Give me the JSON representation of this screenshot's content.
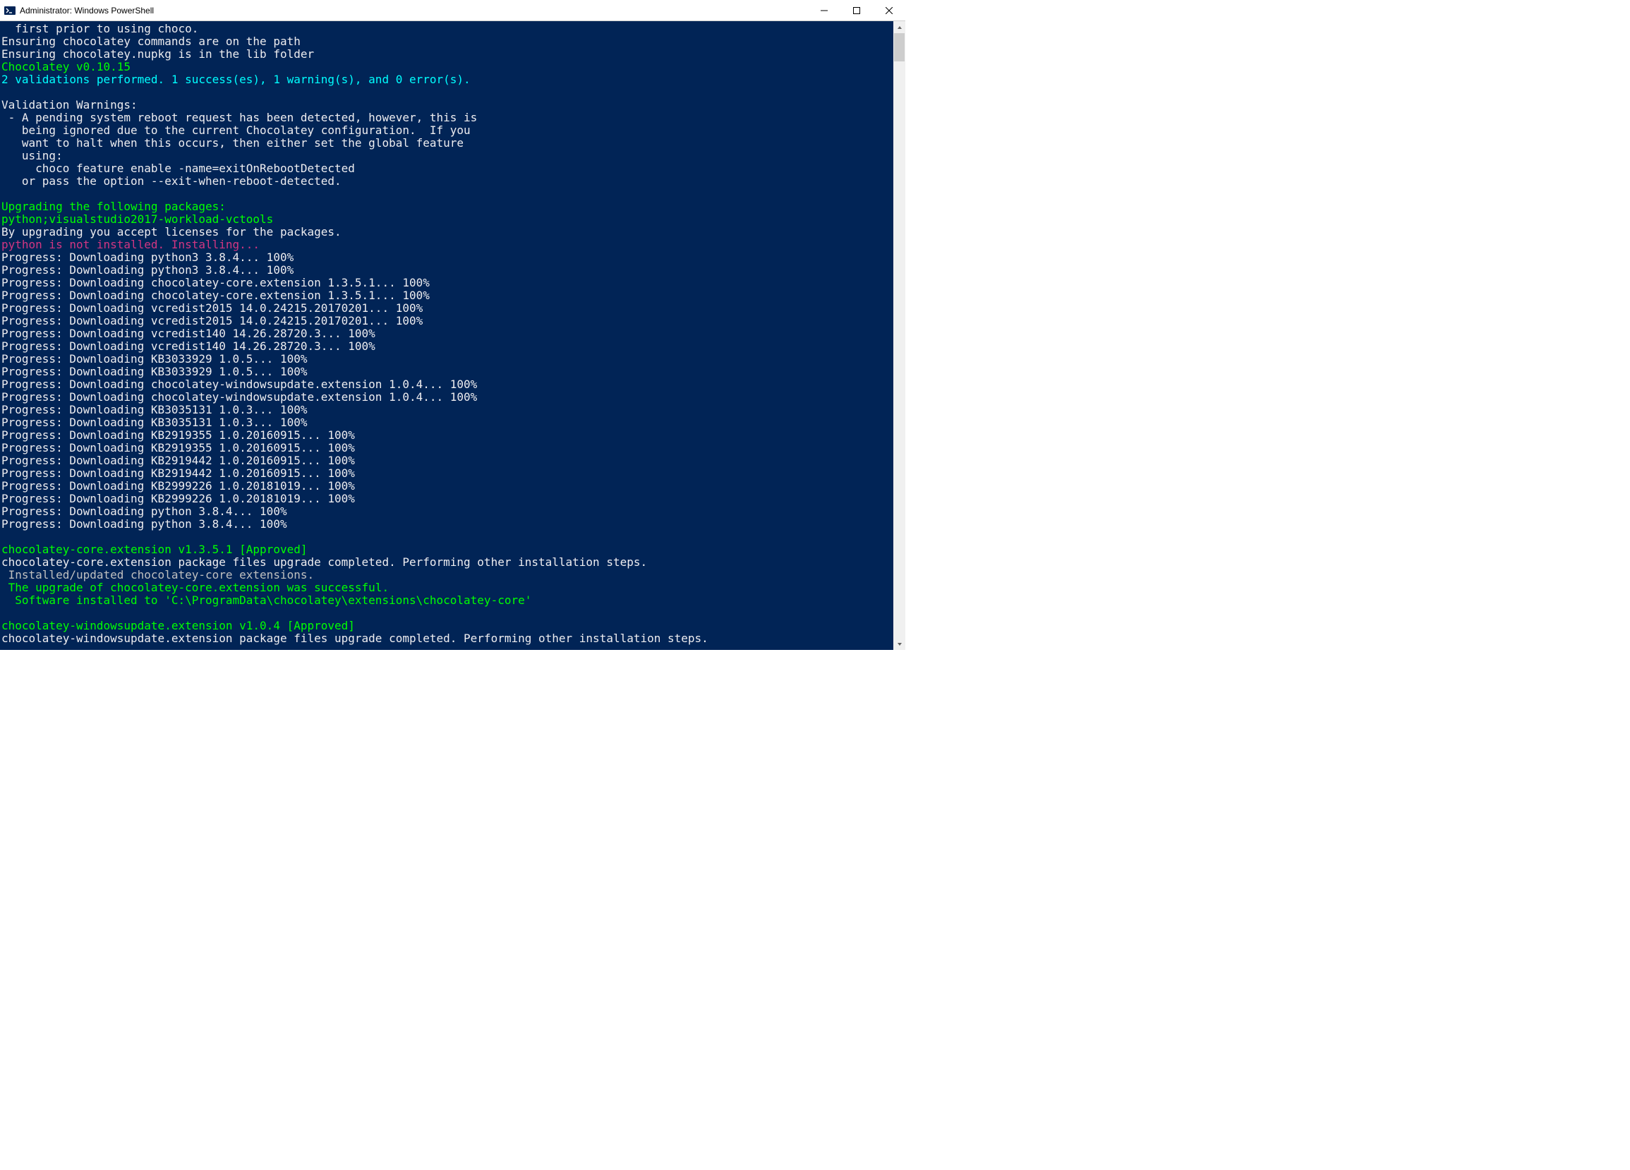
{
  "window": {
    "title": "Administrator: Windows PowerShell"
  },
  "colors": {
    "terminal_bg": "#012456",
    "white": "#eeedf0",
    "silver": "#c0c0c0",
    "green": "#00ff00",
    "cyan": "#00ffff",
    "magenta": "#d33682"
  },
  "lines": [
    {
      "cls": "c-white",
      "t": "  first prior to using choco."
    },
    {
      "cls": "c-white",
      "t": "Ensuring chocolatey commands are on the path"
    },
    {
      "cls": "c-white",
      "t": "Ensuring chocolatey.nupkg is in the lib folder"
    },
    {
      "cls": "c-green",
      "t": "Chocolatey v0.10.15"
    },
    {
      "cls": "c-cyan",
      "t": "2 validations performed. 1 success(es), 1 warning(s), and 0 error(s)."
    },
    {
      "cls": "c-white",
      "t": ""
    },
    {
      "cls": "c-white",
      "t": "Validation Warnings:"
    },
    {
      "cls": "c-white",
      "t": " - A pending system reboot request has been detected, however, this is"
    },
    {
      "cls": "c-white",
      "t": "   being ignored due to the current Chocolatey configuration.  If you"
    },
    {
      "cls": "c-white",
      "t": "   want to halt when this occurs, then either set the global feature"
    },
    {
      "cls": "c-white",
      "t": "   using:"
    },
    {
      "cls": "c-white",
      "t": "     choco feature enable -name=exitOnRebootDetected"
    },
    {
      "cls": "c-white",
      "t": "   or pass the option --exit-when-reboot-detected."
    },
    {
      "cls": "c-white",
      "t": ""
    },
    {
      "cls": "c-green",
      "t": "Upgrading the following packages:"
    },
    {
      "cls": "c-green",
      "t": "python;visualstudio2017-workload-vctools"
    },
    {
      "cls": "c-white",
      "t": "By upgrading you accept licenses for the packages."
    },
    {
      "cls": "c-magenta",
      "t": "python is not installed. Installing..."
    },
    {
      "cls": "c-white",
      "t": "Progress: Downloading python3 3.8.4... 100%"
    },
    {
      "cls": "c-white",
      "t": "Progress: Downloading python3 3.8.4... 100%"
    },
    {
      "cls": "c-white",
      "t": "Progress: Downloading chocolatey-core.extension 1.3.5.1... 100%"
    },
    {
      "cls": "c-white",
      "t": "Progress: Downloading chocolatey-core.extension 1.3.5.1... 100%"
    },
    {
      "cls": "c-white",
      "t": "Progress: Downloading vcredist2015 14.0.24215.20170201... 100%"
    },
    {
      "cls": "c-white",
      "t": "Progress: Downloading vcredist2015 14.0.24215.20170201... 100%"
    },
    {
      "cls": "c-white",
      "t": "Progress: Downloading vcredist140 14.26.28720.3... 100%"
    },
    {
      "cls": "c-white",
      "t": "Progress: Downloading vcredist140 14.26.28720.3... 100%"
    },
    {
      "cls": "c-white",
      "t": "Progress: Downloading KB3033929 1.0.5... 100%"
    },
    {
      "cls": "c-white",
      "t": "Progress: Downloading KB3033929 1.0.5... 100%"
    },
    {
      "cls": "c-white",
      "t": "Progress: Downloading chocolatey-windowsupdate.extension 1.0.4... 100%"
    },
    {
      "cls": "c-white",
      "t": "Progress: Downloading chocolatey-windowsupdate.extension 1.0.4... 100%"
    },
    {
      "cls": "c-white",
      "t": "Progress: Downloading KB3035131 1.0.3... 100%"
    },
    {
      "cls": "c-white",
      "t": "Progress: Downloading KB3035131 1.0.3... 100%"
    },
    {
      "cls": "c-white",
      "t": "Progress: Downloading KB2919355 1.0.20160915... 100%"
    },
    {
      "cls": "c-white",
      "t": "Progress: Downloading KB2919355 1.0.20160915... 100%"
    },
    {
      "cls": "c-white",
      "t": "Progress: Downloading KB2919442 1.0.20160915... 100%"
    },
    {
      "cls": "c-white",
      "t": "Progress: Downloading KB2919442 1.0.20160915... 100%"
    },
    {
      "cls": "c-white",
      "t": "Progress: Downloading KB2999226 1.0.20181019... 100%"
    },
    {
      "cls": "c-white",
      "t": "Progress: Downloading KB2999226 1.0.20181019... 100%"
    },
    {
      "cls": "c-white",
      "t": "Progress: Downloading python 3.8.4... 100%"
    },
    {
      "cls": "c-white",
      "t": "Progress: Downloading python 3.8.4... 100%"
    },
    {
      "cls": "c-white",
      "t": ""
    },
    {
      "cls": "c-green",
      "t": "chocolatey-core.extension v1.3.5.1 [Approved]"
    },
    {
      "cls": "c-white",
      "t": "chocolatey-core.extension package files upgrade completed. Performing other installation steps."
    },
    {
      "cls": "c-silver",
      "t": " Installed/updated chocolatey-core extensions."
    },
    {
      "cls": "c-green",
      "t": " The upgrade of chocolatey-core.extension was successful."
    },
    {
      "cls": "c-green",
      "t": "  Software installed to 'C:\\ProgramData\\chocolatey\\extensions\\chocolatey-core'"
    },
    {
      "cls": "c-white",
      "t": ""
    },
    {
      "cls": "c-green",
      "t": "chocolatey-windowsupdate.extension v1.0.4 [Approved]"
    },
    {
      "cls": "c-white",
      "t": "chocolatey-windowsupdate.extension package files upgrade completed. Performing other installation steps."
    }
  ]
}
